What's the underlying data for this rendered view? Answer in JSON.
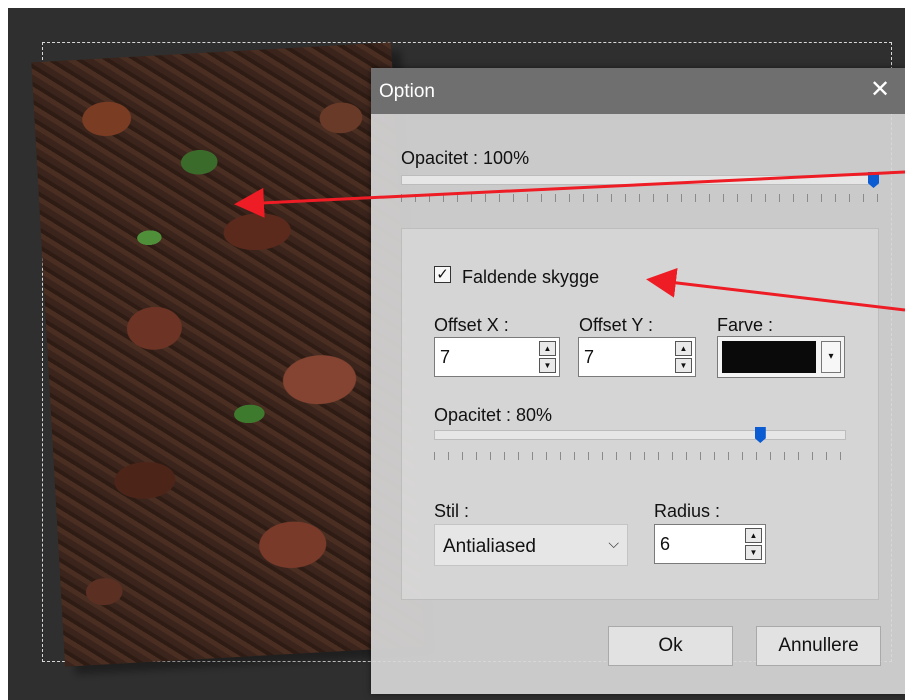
{
  "dialog": {
    "title": "Option",
    "close_glyph": "✕",
    "opacity_label": "Opacitet : 100%",
    "opacity_value_pct": 100,
    "shadow": {
      "checkbox_label": "Faldende skygge",
      "checked": true,
      "check_glyph": "✓",
      "offset_x_label": "Offset X :",
      "offset_x_value": "7",
      "offset_y_label": "Offset Y :",
      "offset_y_value": "7",
      "color_label": "Farve :",
      "color_value": "#0a0a0a",
      "opacity_label": "Opacitet : 80%",
      "opacity_value_pct": 80,
      "style_label": "Stil :",
      "style_value": "Antialiased",
      "radius_label": "Radius :",
      "radius_value": "6"
    },
    "ok_label": "Ok",
    "cancel_label": "Annullere"
  },
  "icons": {
    "spin_up": "▲",
    "spin_down": "▼",
    "dropdown": "▾",
    "chevron": "⌵"
  },
  "colors": {
    "slider_thumb": "#0b5bd3",
    "annotation_arrow": "#ee1c24",
    "canvas_bg": "#2f2f2f"
  }
}
